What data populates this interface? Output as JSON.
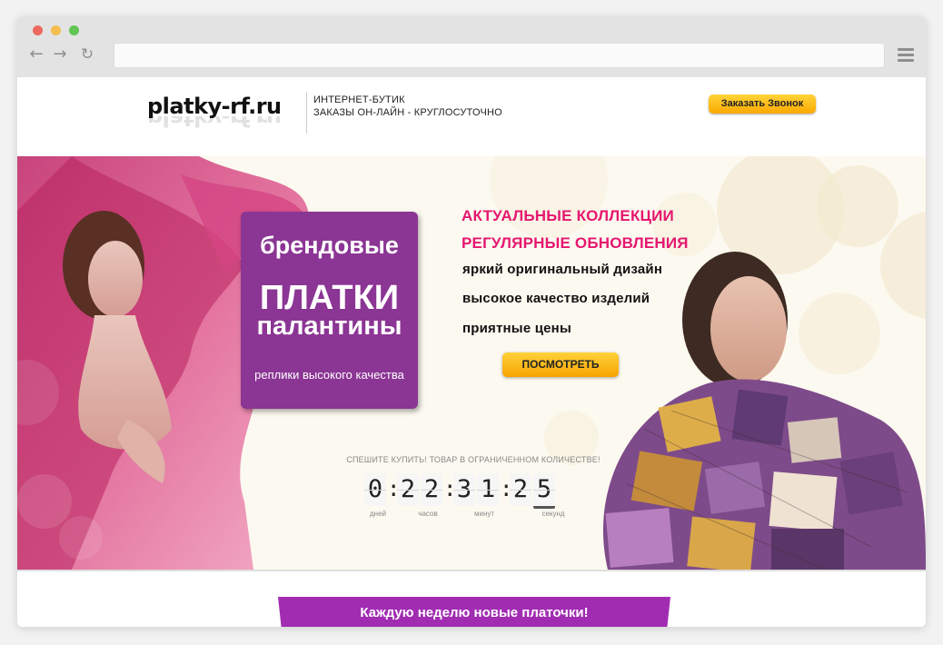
{
  "browser": {
    "url": "",
    "nav": {
      "back_icon": "back-arrow-icon",
      "forward_icon": "forward-arrow-icon",
      "reload_icon": "reload-icon",
      "menu_icon": "hamburger-menu-icon"
    }
  },
  "header": {
    "logo": "platky-rf.ru",
    "tagline_line1": "ИНТЕРНЕТ-БУТИК",
    "tagline_line2": "ЗАКАЗЫ ОН-ЛАЙН - КРУГЛОСУТОЧНО",
    "callback_button": "Заказать Звонок"
  },
  "hero": {
    "promo": {
      "line1": "брендовые",
      "line2": "ПЛАТКИ",
      "line3": "палантины",
      "line4": "реплики высокого качества"
    },
    "headline1": "АКТУАЛЬНЫЕ КОЛЛЕКЦИИ",
    "headline2": "РЕГУЛЯРНЫЕ ОБНОВЛЕНИЯ",
    "features": [
      "яркий оригинальный дизайн",
      "высокое качество изделий",
      "приятные цены"
    ],
    "view_button": "ПОСМОТРЕТЬ",
    "hurry_text": "СПЕШИТЕ КУПИТЬ! ТОВАР В ОГРАНИЧЕННОМ КОЛИЧЕСТВЕ!",
    "countdown": {
      "digits": [
        "0",
        "2",
        "2",
        "3",
        "1",
        "2",
        "5"
      ],
      "units": [
        "дней",
        "часов",
        "минут",
        "секунд"
      ]
    }
  },
  "banner": {
    "text": "Каждую неделю новые платочки!"
  },
  "colors": {
    "accent_pink": "#e5176f",
    "promo_purple": "#8b3594",
    "button_yellow": "#fbb400",
    "banner_purple": "#a12cb2"
  }
}
